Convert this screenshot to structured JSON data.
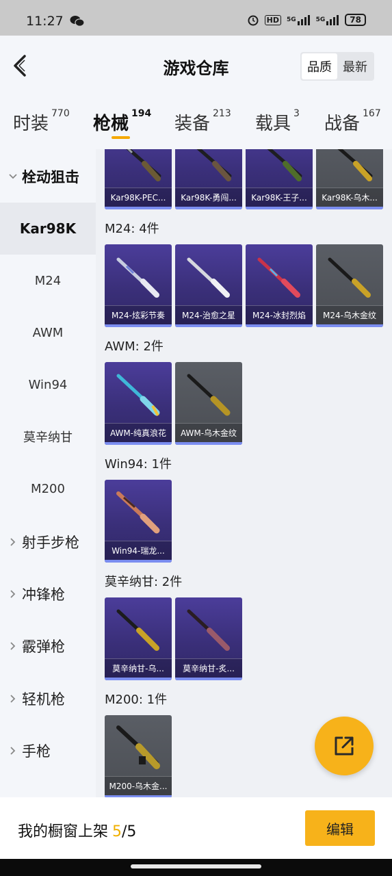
{
  "status_bar": {
    "time": "11:27",
    "icons": [
      "wechat-icon",
      "alarm-icon",
      "hd-icon",
      "signal-5g-icon",
      "signal-5g-icon-2"
    ],
    "hd": "HD",
    "net1": "5G",
    "net2": "5G",
    "battery": "78"
  },
  "header": {
    "title": "游戏仓库",
    "sort_options": [
      "品质",
      "最新"
    ]
  },
  "tabs": [
    {
      "label": "时装",
      "count": "770"
    },
    {
      "label": "枪械",
      "count": "194"
    },
    {
      "label": "装备",
      "count": "213"
    },
    {
      "label": "载具",
      "count": "3"
    },
    {
      "label": "战备",
      "count": "167"
    }
  ],
  "sidebar": {
    "expanded_category": "栓动狙击",
    "sub_items": [
      "Kar98K",
      "M24",
      "AWM",
      "Win94",
      "莫辛纳甘",
      "M200"
    ],
    "categories": [
      "射手步枪",
      "冲锋枪",
      "霰弹枪",
      "轻机枪",
      "手枪"
    ]
  },
  "sections": {
    "kar98k": {
      "items": [
        "Kar98K-PEC...",
        "Kar98K-勇闯...",
        "Kar98K-王子...",
        "Kar98K-乌木..."
      ]
    },
    "m24": {
      "title": "M24: 4件",
      "items": [
        "M24-炫彩节奏",
        "M24-治愈之星",
        "M24-冰封烈焰",
        "M24-乌木金纹"
      ]
    },
    "awm": {
      "title": "AWM: 2件",
      "items": [
        "AWM-纯真浪花",
        "AWM-乌木金纹"
      ]
    },
    "win94": {
      "title": "Win94: 1件",
      "items": [
        "Win94-瑞龙..."
      ]
    },
    "mosin": {
      "title": "莫辛纳甘: 2件",
      "items": [
        "莫辛纳甘-乌...",
        "莫辛纳甘-炙..."
      ]
    },
    "m200": {
      "title": "M200: 1件",
      "items": [
        "M200-乌木金..."
      ]
    }
  },
  "colors": {
    "accent": "#f7b21a",
    "card_purple": "#3a2f79",
    "card_gray": "#4e5157",
    "card_bar": "#7b8df0"
  },
  "bottom": {
    "showcase_label": "我的橱窗上架",
    "showcase_used": "5",
    "showcase_total": "/5",
    "edit_label": "编辑"
  }
}
